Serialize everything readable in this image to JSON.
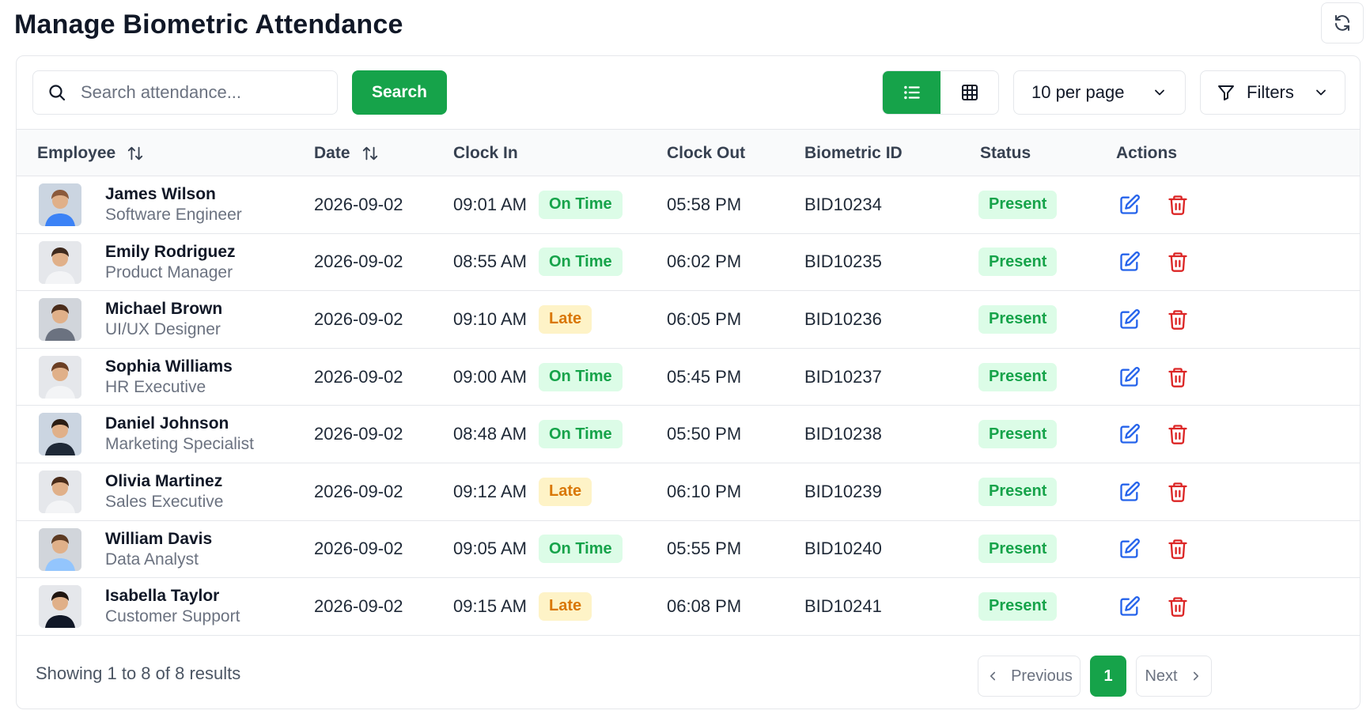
{
  "page": {
    "title": "Manage Biometric Attendance"
  },
  "toolbar": {
    "search_placeholder": "Search attendance...",
    "search_label": "Search",
    "per_page": "10 per page",
    "filters_label": "Filters"
  },
  "table": {
    "headers": {
      "employee": "Employee",
      "date": "Date",
      "clock_in": "Clock In",
      "clock_out": "Clock Out",
      "biometric_id": "Biometric ID",
      "status": "Status",
      "actions": "Actions"
    },
    "rows": [
      {
        "name": "James Wilson",
        "role": "Software Engineer",
        "date": "2026-09-02",
        "clock_in": "09:01 AM",
        "punctuality": "On Time",
        "clock_out": "05:58 PM",
        "biometric_id": "BID10234",
        "status": "Present"
      },
      {
        "name": "Emily Rodriguez",
        "role": "Product Manager",
        "date": "2026-09-02",
        "clock_in": "08:55 AM",
        "punctuality": "On Time",
        "clock_out": "06:02 PM",
        "biometric_id": "BID10235",
        "status": "Present"
      },
      {
        "name": "Michael Brown",
        "role": "UI/UX Designer",
        "date": "2026-09-02",
        "clock_in": "09:10 AM",
        "punctuality": "Late",
        "clock_out": "06:05 PM",
        "biometric_id": "BID10236",
        "status": "Present"
      },
      {
        "name": "Sophia Williams",
        "role": "HR Executive",
        "date": "2026-09-02",
        "clock_in": "09:00 AM",
        "punctuality": "On Time",
        "clock_out": "05:45 PM",
        "biometric_id": "BID10237",
        "status": "Present"
      },
      {
        "name": "Daniel Johnson",
        "role": "Marketing Specialist",
        "date": "2026-09-02",
        "clock_in": "08:48 AM",
        "punctuality": "On Time",
        "clock_out": "05:50 PM",
        "biometric_id": "BID10238",
        "status": "Present"
      },
      {
        "name": "Olivia Martinez",
        "role": "Sales Executive",
        "date": "2026-09-02",
        "clock_in": "09:12 AM",
        "punctuality": "Late",
        "clock_out": "06:10 PM",
        "biometric_id": "BID10239",
        "status": "Present"
      },
      {
        "name": "William Davis",
        "role": "Data Analyst",
        "date": "2026-09-02",
        "clock_in": "09:05 AM",
        "punctuality": "On Time",
        "clock_out": "05:55 PM",
        "biometric_id": "BID10240",
        "status": "Present"
      },
      {
        "name": "Isabella Taylor",
        "role": "Customer Support",
        "date": "2026-09-02",
        "clock_in": "09:15 AM",
        "punctuality": "Late",
        "clock_out": "06:08 PM",
        "biometric_id": "BID10241",
        "status": "Present"
      }
    ]
  },
  "pagination": {
    "summary": "Showing 1 to 8 of 8 results",
    "previous_label": "Previous",
    "current_page": "1",
    "next_label": "Next"
  },
  "colors": {
    "accent": "#16a34a",
    "edit": "#2563eb",
    "delete": "#dc2626",
    "late": "#d97706"
  },
  "icons": {
    "refresh": "refresh-icon",
    "search": "search-icon",
    "list_view": "list-view-icon",
    "grid_view": "grid-view-icon",
    "dropdown": "chevron-down-icon",
    "filter": "filter-icon",
    "sort": "sort-icon",
    "edit": "edit-icon",
    "delete": "trash-icon"
  }
}
